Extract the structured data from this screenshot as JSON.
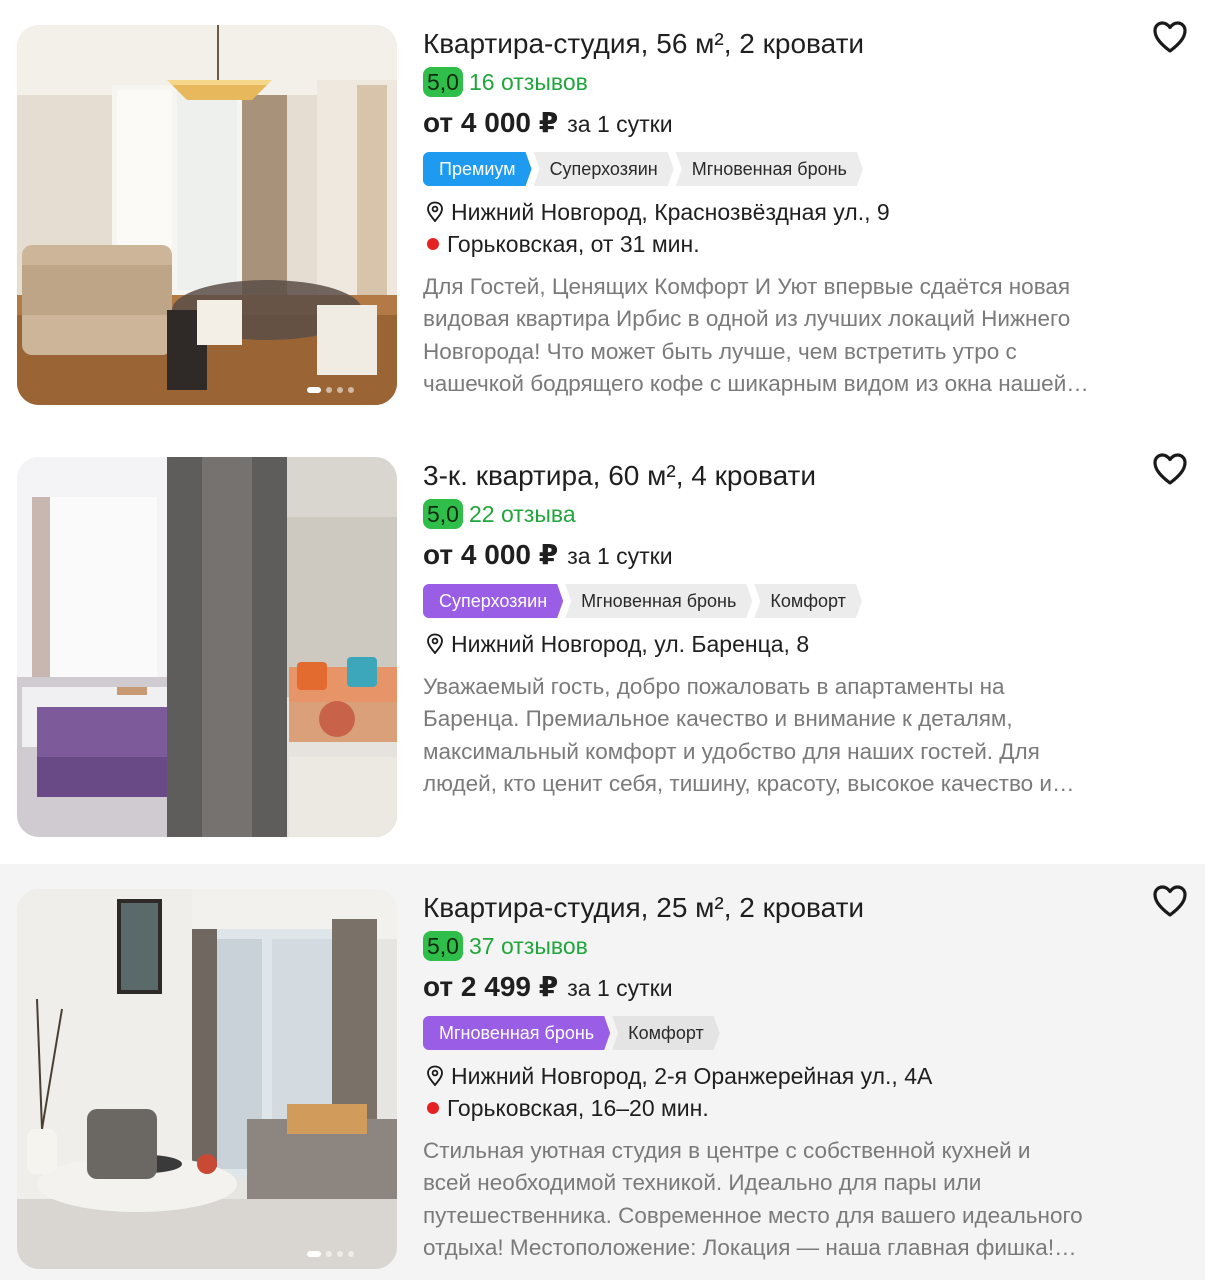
{
  "listings": [
    {
      "title": "Квартира-студия, 56 м², 2 кровати",
      "rating": "5,0",
      "reviews": "16 отзывов",
      "price": "от 4 000 ₽",
      "price_unit": "за 1 сутки",
      "tags": [
        {
          "label": "Премиум",
          "color": "#1e9bf0"
        },
        {
          "label": "Суперхозяин"
        },
        {
          "label": "Мгновенная бронь"
        }
      ],
      "address": "Нижний Новгород, Краснозвёздная ул., 9",
      "metro": "Горьковская, от 31 мин.",
      "description": [
        "Для Гостей, Ценящих Комфорт И Уют впервые сдаётся новая",
        "видовая квартира Ирбис в одной из лучших локаций Нижнего",
        "Новгорода! Что может быть лучше, чем встретить утро с",
        "чашечкой бодрящего кофе с шикарным видом из окна нашей…"
      ]
    },
    {
      "title": "3-к. квартира, 60 м², 4 кровати",
      "rating": "5,0",
      "reviews": "22 отзыва",
      "price": "от 4 000 ₽",
      "price_unit": "за 1 сутки",
      "tags": [
        {
          "label": "Суперхозяин",
          "color": "#9a5de6"
        },
        {
          "label": "Мгновенная бронь"
        },
        {
          "label": "Комфорт"
        }
      ],
      "address": "Нижний Новгород, ул. Баренца, 8",
      "metro": "",
      "description": [
        "Уважаемый гость, добро пожаловать в апартаменты на",
        "Баренца. Премиальное качество и внимание к деталям,",
        "максимальный комфорт и удобство для наших гостей. Для",
        "людей, кто ценит себя, тишину, красоту, высокое качество и…"
      ]
    },
    {
      "title": "Квартира-студия, 25 м², 2 кровати",
      "rating": "5,0",
      "reviews": "37 отзывов",
      "price": "от 2 499 ₽",
      "price_unit": "за 1 сутки",
      "tags": [
        {
          "label": "Мгновенная бронь",
          "color": "#9a5de6"
        },
        {
          "label": "Комфорт"
        }
      ],
      "address": "Нижний Новгород, 2-я Оранжерейная ул., 4А",
      "metro": "Горьковская, 16–20 мин.",
      "description": [
        "Стильная уютная студия в центре с собственной кухней и",
        "всей необходимой техникой. Идеально для пары или",
        "путешественника. Современное место для вашего идеального",
        "отдыха! Местоположение: Локация — наша главная фишка!…"
      ]
    }
  ]
}
